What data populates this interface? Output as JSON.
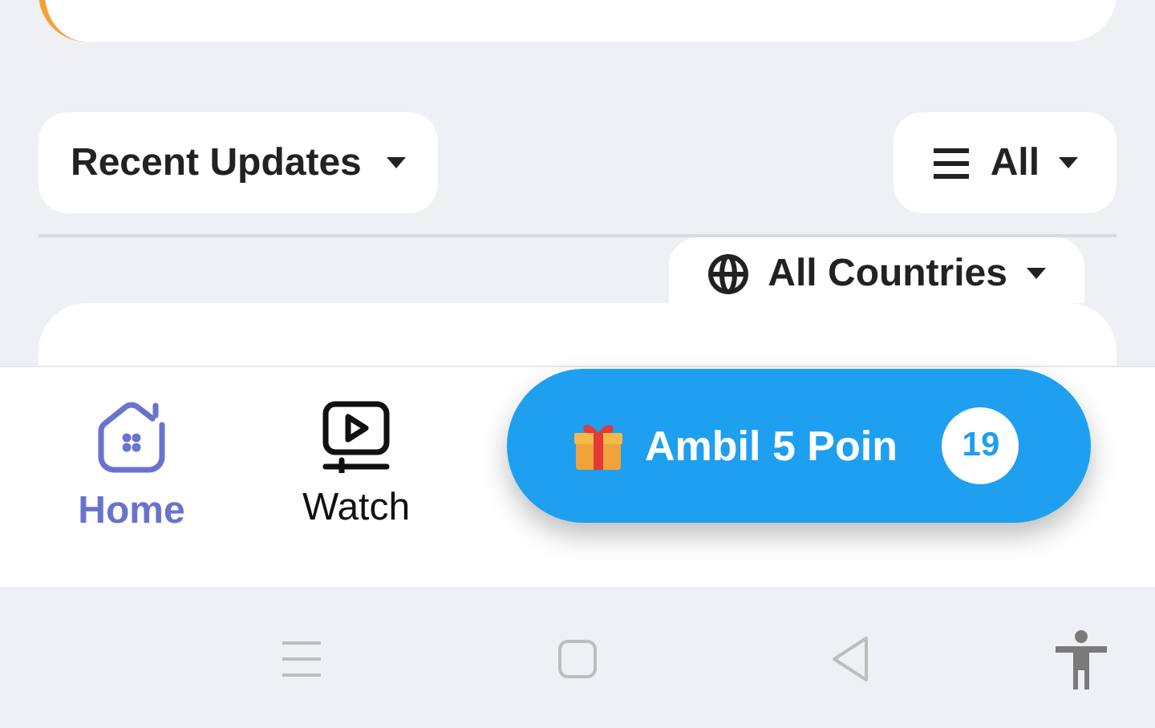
{
  "filters": {
    "sort": {
      "label": "Recent Updates"
    },
    "type": {
      "label": "All"
    },
    "country": {
      "label": "All Countries"
    }
  },
  "bottom_nav": [
    {
      "label": "Home",
      "kind": "home",
      "selected": true
    },
    {
      "label": "Watch",
      "kind": "watch",
      "selected": false
    }
  ],
  "points_button": {
    "label": "Ambil 5 Poin",
    "count": "19"
  }
}
